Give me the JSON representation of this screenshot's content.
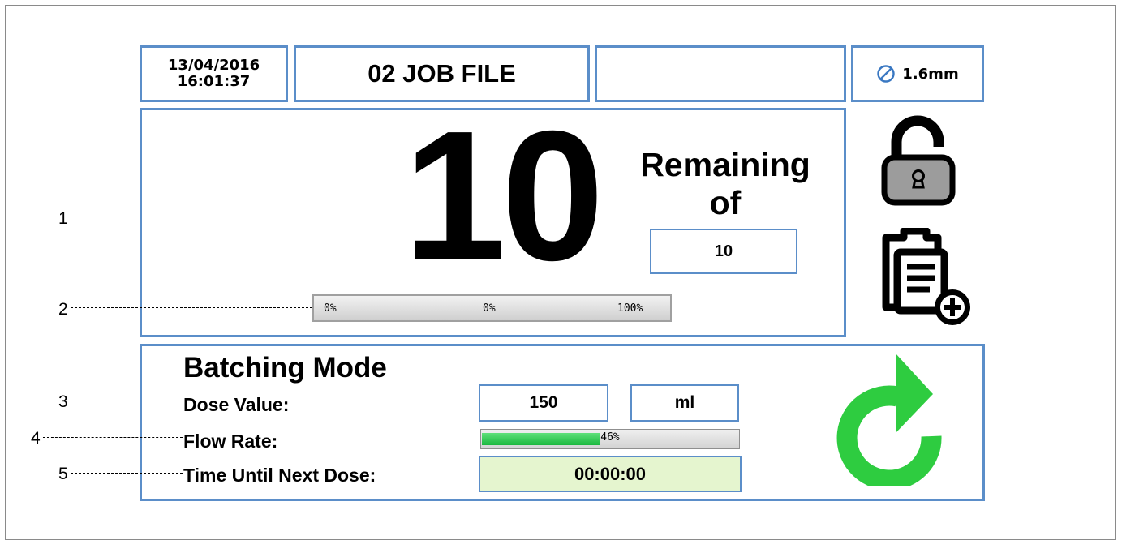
{
  "header": {
    "date": "13/04/2016",
    "time": "16:01:37",
    "job_title": "02 JOB FILE",
    "empty_field": "",
    "nozzle_size": "1.6mm"
  },
  "counter": {
    "remaining_count": "10",
    "remaining_label": "Remaining",
    "of_label": "of",
    "total": "10"
  },
  "job_progress": {
    "left_label": "0%",
    "current_label": "0%",
    "right_label": "100%",
    "fraction": 0
  },
  "batching": {
    "title": "Batching Mode",
    "dose_label": "Dose Value:",
    "dose_value": "150",
    "dose_unit": "ml",
    "flow_label": "Flow Rate:",
    "flow_percent_label": "46%",
    "flow_fraction": 0.46,
    "time_label": "Time Until Next Dose:",
    "time_value": "00:00:00"
  },
  "icons": {
    "nozzle": "nozzle-diameter-icon",
    "lock": "unlocked-padlock-icon",
    "add_file": "add-file-icon",
    "refresh": "refresh-icon"
  },
  "callouts": [
    "1",
    "2",
    "3",
    "4",
    "5"
  ],
  "colors": {
    "border": "#5b8ec9",
    "accent_green": "#2ecc40",
    "time_bg": "#e5f5cf"
  }
}
